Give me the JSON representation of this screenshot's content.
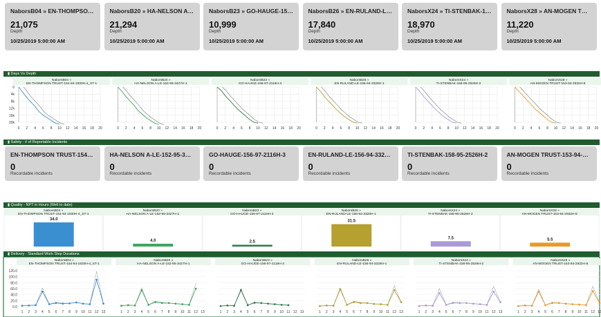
{
  "depth_cards": [
    {
      "title": "NaborsB04 » EN-THOMPSON TRUST...",
      "value": "21,075",
      "unit": "Depth",
      "date": "10/25/2019 5:00:00 AM"
    },
    {
      "title": "NaborsB20 » HA-NELSON A-LE-15...",
      "value": "21,294",
      "unit": "Depth",
      "date": "10/25/2019 5:00:00 AM"
    },
    {
      "title": "NaborsB23 » GO-HAUGE-156-97-...",
      "value": "10,999",
      "unit": "Depth",
      "date": "10/25/2019 5:00:00 AM"
    },
    {
      "title": "NaborsB26 » EN-RULAND-LE-156-...",
      "value": "17,840",
      "unit": "Depth",
      "date": "10/25/2019 5:00:00 AM"
    },
    {
      "title": "NaborsX24 » TI-STENBAK-158-95-...",
      "value": "18,970",
      "unit": "Depth",
      "date": "10/25/2019 5:00:00 AM"
    },
    {
      "title": "NaborsX28 » AN-MOGEN TRUST-1...",
      "value": "11,220",
      "unit": "Depth",
      "date": "10/25/2019 5:00:00 AM"
    }
  ],
  "sections": {
    "days_vs_depth": "Days Vs Depth",
    "safety": "Safety - # of Reportable Incidents",
    "quality": "Quality - NPT in Hours (Well to date)",
    "delivery": "Delivery - Standard Work Step Durations"
  },
  "rigs": [
    {
      "rig": "NaborsB04 »",
      "well": "EN-THOMPSON TRUST-154-94-1930H-4_ST-1",
      "color": "#3a8fd0"
    },
    {
      "rig": "NaborsB20 »",
      "well": "HA-NELSON A-LE-152-95-3427H-1",
      "color": "#3fa55f"
    },
    {
      "rig": "NaborsB23 »",
      "well": "GO-HAUGE-156-97-2116H-3",
      "color": "#2e7d4f"
    },
    {
      "rig": "NaborsB26 »",
      "well": "EN-RULAND-LE-156-94-3328H-1",
      "color": "#b5a030"
    },
    {
      "rig": "NaborsX24 »",
      "well": "TI-STENBAK-158-95-2526H-2",
      "color": "#a99ad8"
    },
    {
      "rig": "NaborsX28 »",
      "well": "AN-MOGEN TRUST-153-94-2932H-8",
      "color": "#e89a2a"
    }
  ],
  "safety_cards": [
    {
      "title": "EN-THOMPSON TRUST-154-94-193...",
      "value": "0",
      "unit": "Recordable incidents"
    },
    {
      "title": "HA-NELSON A-LE-152-95-3427H-1",
      "value": "0",
      "unit": "Recordable incidents"
    },
    {
      "title": "GO-HAUGE-156-97-2116H-3",
      "value": "0",
      "unit": "Recordable incidents"
    },
    {
      "title": "EN-RULAND-LE-156-94-3328H-1",
      "value": "0",
      "unit": "Recordable incidents"
    },
    {
      "title": "TI-STENBAK-158-95-2526H-2",
      "value": "0",
      "unit": "Recordable incidents"
    },
    {
      "title": "AN-MOGEN TRUST-153-94-2932H-8",
      "value": "0",
      "unit": "Recordable incidents"
    }
  ],
  "chart_data": [
    {
      "type": "line",
      "chart": "days_vs_depth",
      "ylim": [
        0,
        20000
      ],
      "yticks": [
        "0",
        "4k",
        "8k",
        "12k",
        "16k",
        "20k"
      ],
      "xlim": [
        0,
        20
      ],
      "xticks": [
        "0",
        "2",
        "4",
        "6",
        "8",
        "10",
        "12",
        "14",
        "16",
        "18",
        "20"
      ],
      "series": [
        {
          "rig_index": 0,
          "x": [
            0,
            1,
            2,
            3,
            4,
            5,
            6,
            7,
            8,
            9,
            10
          ],
          "y": [
            0,
            3000,
            6000,
            8500,
            11000,
            14000,
            16000,
            17500,
            19000,
            20500,
            21075
          ]
        },
        {
          "rig_index": 1,
          "x": [
            0,
            1,
            2,
            3,
            4,
            5,
            6,
            7,
            8,
            9,
            10
          ],
          "y": [
            0,
            2500,
            5500,
            8000,
            10500,
            13500,
            15500,
            17500,
            19000,
            20500,
            21294
          ]
        },
        {
          "rig_index": 2,
          "x": [
            0,
            1,
            2,
            3,
            4,
            5,
            6,
            7,
            8,
            9,
            10
          ],
          "y": [
            0,
            2000,
            5000,
            7500,
            10000,
            12500,
            14500,
            16500,
            18500,
            20000,
            20500
          ]
        },
        {
          "rig_index": 3,
          "x": [
            0,
            1,
            2,
            3,
            4,
            5,
            6,
            7,
            8,
            9,
            10
          ],
          "y": [
            0,
            2500,
            5500,
            8000,
            10500,
            13000,
            15000,
            17000,
            18500,
            20000,
            20500
          ]
        },
        {
          "rig_index": 4,
          "x": [
            0,
            1,
            2,
            3,
            4,
            5,
            6,
            7,
            8,
            9,
            10
          ],
          "y": [
            0,
            2500,
            5500,
            8000,
            10500,
            13000,
            15000,
            17000,
            18500,
            20000,
            20500
          ]
        },
        {
          "rig_index": 5,
          "x": [
            0,
            1,
            2,
            3,
            4,
            5,
            6,
            7,
            8,
            9,
            10
          ],
          "y": [
            0,
            2500,
            5000,
            7500,
            10000,
            12500,
            14500,
            16500,
            18500,
            20000,
            20500
          ]
        }
      ]
    },
    {
      "type": "bar",
      "chart": "quality_npt",
      "categories": [
        "EN-THOMPSON TRUST-154-94-1930H-4_ST-1",
        "HA-NELSON A-LE-152-95-3427H-1",
        "GO-HAUGE-156-97-2116H-3",
        "EN-RULAND-LE-156-94-3328H-1",
        "TI-STENBAK-158-95-2526H-2",
        "AN-MOGEN TRUST-153-94-2932H-8"
      ],
      "values": [
        34.0,
        4.0,
        2.5,
        31.5,
        7.5,
        5.5
      ],
      "labels": [
        "34.0",
        "4.0",
        "2.5",
        "31.5",
        "7.5",
        "5.5"
      ]
    },
    {
      "type": "line",
      "chart": "delivery",
      "ylim": [
        0,
        120
      ],
      "yticks": [
        "0.0",
        "20.0",
        "40.0",
        "60.0",
        "80.0",
        "100.0",
        "120.0"
      ],
      "series": [
        {
          "rig_index": 0,
          "x": [
            1,
            2,
            3,
            4,
            5,
            6,
            7,
            8,
            9,
            10,
            11,
            12,
            13
          ],
          "y": [
            3,
            4,
            5,
            62,
            8,
            15,
            12,
            11,
            14,
            10,
            8,
            118,
            10
          ],
          "y2": [
            3,
            4,
            5,
            50,
            8,
            12,
            10,
            11,
            14,
            10,
            8,
            90,
            10
          ]
        },
        {
          "rig_index": 1,
          "x": [
            1,
            2,
            3,
            4,
            5,
            6,
            7,
            8,
            9,
            10,
            11,
            12
          ],
          "y": [
            3,
            5,
            4,
            62,
            6,
            18,
            14,
            12,
            10,
            8,
            6,
            78
          ],
          "y2": [
            3,
            5,
            4,
            55,
            6,
            15,
            12,
            12,
            10,
            8,
            6,
            60
          ]
        },
        {
          "rig_index": 2,
          "x": [
            1,
            2,
            3,
            4,
            5,
            6,
            7,
            8,
            9,
            10,
            11
          ],
          "y": [
            2,
            4,
            3,
            60,
            5,
            15,
            12,
            10,
            8,
            6,
            5
          ],
          "y2": [
            2,
            4,
            3,
            55,
            5,
            13,
            12,
            10,
            8,
            6,
            5
          ]
        },
        {
          "rig_index": 3,
          "x": [
            1,
            2,
            3,
            4,
            5,
            6,
            7,
            8,
            9,
            10,
            11,
            12,
            13
          ],
          "y": [
            2,
            4,
            3,
            63,
            6,
            18,
            14,
            12,
            9,
            8,
            6,
            70,
            15
          ],
          "y2": [
            2,
            4,
            3,
            58,
            6,
            15,
            12,
            12,
            9,
            8,
            6,
            55,
            15
          ]
        },
        {
          "rig_index": 4,
          "x": [
            1,
            2,
            3,
            4,
            5,
            6,
            7,
            8,
            9,
            10,
            11,
            12,
            13
          ],
          "y": [
            2,
            4,
            3,
            60,
            6,
            15,
            13,
            12,
            10,
            8,
            6,
            68,
            15
          ],
          "y2": [
            2,
            4,
            3,
            45,
            6,
            12,
            12,
            12,
            10,
            8,
            6,
            50,
            15
          ]
        },
        {
          "rig_index": 5,
          "x": [
            1,
            2,
            3,
            4,
            5,
            6,
            7,
            8,
            9,
            10,
            11,
            12,
            13
          ],
          "y": [
            2,
            4,
            3,
            58,
            5,
            15,
            12,
            10,
            8,
            7,
            5,
            68,
            12
          ],
          "y2": [
            2,
            4,
            3,
            50,
            5,
            12,
            12,
            10,
            8,
            7,
            5,
            52,
            12
          ]
        }
      ],
      "xticks_per_panel": [
        [
          "1",
          "2",
          "3",
          "4",
          "5",
          "6",
          "7",
          "8",
          "9",
          "10",
          "11",
          "12",
          "13"
        ],
        [
          "1",
          "2",
          "3",
          "4",
          "5",
          "6",
          "7",
          "8",
          "9",
          "10",
          "11",
          "12",
          "13"
        ],
        [
          "1",
          "2",
          "3",
          "4",
          "5",
          "6",
          "7",
          "8",
          "9",
          "10",
          "11",
          "12",
          "13"
        ],
        [
          "1",
          "2",
          "3",
          "4",
          "5",
          "6",
          "7",
          "8",
          "9",
          "10",
          "11",
          "12",
          "13"
        ],
        [
          "1",
          "2",
          "3",
          "4",
          "5",
          "6",
          "7",
          "8",
          "9",
          "10",
          "11",
          "12",
          "13"
        ],
        [
          "1",
          "2",
          "3",
          "4",
          "5",
          "6",
          "7",
          "8",
          "9",
          "10",
          "11",
          "12",
          "13"
        ]
      ]
    }
  ]
}
